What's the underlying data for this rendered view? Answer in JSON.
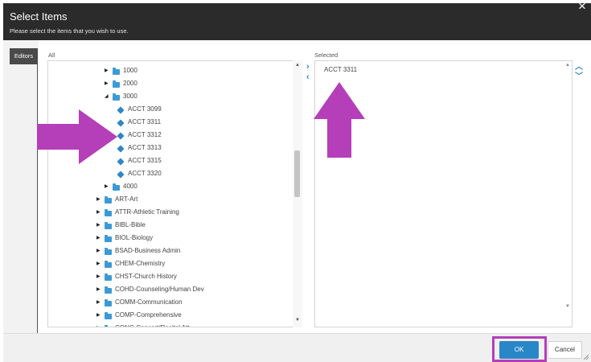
{
  "dialog": {
    "title": "Select Items",
    "subtitle": "Please select the items that you wish to use.",
    "close_glyph": "×"
  },
  "left_rail": {
    "tab_label": "Editors"
  },
  "panels": {
    "all_label": "All",
    "selected_label": "Selected"
  },
  "tree": [
    {
      "label": "1000",
      "type": "folder",
      "state": "collapsed"
    },
    {
      "label": "2000",
      "type": "folder",
      "state": "collapsed"
    },
    {
      "label": "3000",
      "type": "folder",
      "state": "expanded"
    },
    {
      "label": "ACCT 3099",
      "type": "item"
    },
    {
      "label": "ACCT 3311",
      "type": "item"
    },
    {
      "label": "ACCT 3312",
      "type": "item"
    },
    {
      "label": "ACCT 3313",
      "type": "item"
    },
    {
      "label": "ACCT 3315",
      "type": "item"
    },
    {
      "label": "ACCT 3320",
      "type": "item"
    },
    {
      "label": "4000",
      "type": "folder",
      "state": "collapsed"
    },
    {
      "label": "ART-Art",
      "type": "folder",
      "state": "collapsed"
    },
    {
      "label": "ATTR-Athletic Training",
      "type": "folder",
      "state": "collapsed"
    },
    {
      "label": "BIBL-Bible",
      "type": "folder",
      "state": "collapsed"
    },
    {
      "label": "BIOL-Biology",
      "type": "folder",
      "state": "collapsed"
    },
    {
      "label": "BSAD-Business Admin",
      "type": "folder",
      "state": "collapsed"
    },
    {
      "label": "CHEM-Chemistry",
      "type": "folder",
      "state": "collapsed"
    },
    {
      "label": "CHST-Church History",
      "type": "folder",
      "state": "collapsed"
    },
    {
      "label": "COHD-Counseling/Human Dev",
      "type": "folder",
      "state": "collapsed"
    },
    {
      "label": "COMM-Communication",
      "type": "folder",
      "state": "collapsed"
    },
    {
      "label": "COMP-Comprehensive",
      "type": "folder",
      "state": "collapsed"
    },
    {
      "label": "CONC-Concert/Recital Att",
      "type": "folder",
      "state": "collapsed"
    }
  ],
  "selected_items": [
    "ACCT 3311"
  ],
  "footer": {
    "ok_label": "OK",
    "cancel_label": "Cancel"
  },
  "colors": {
    "header_bg": "#2b2b2b",
    "accent": "#2987c8",
    "annotation": "#b43fb9"
  },
  "icons": {
    "close": "close-icon",
    "folder": "folder-icon",
    "item": "course-item-icon",
    "add": "chevron-right-icon",
    "remove": "chevron-left-icon",
    "move_up": "chevron-up-icon",
    "move_down": "chevron-down-icon"
  }
}
